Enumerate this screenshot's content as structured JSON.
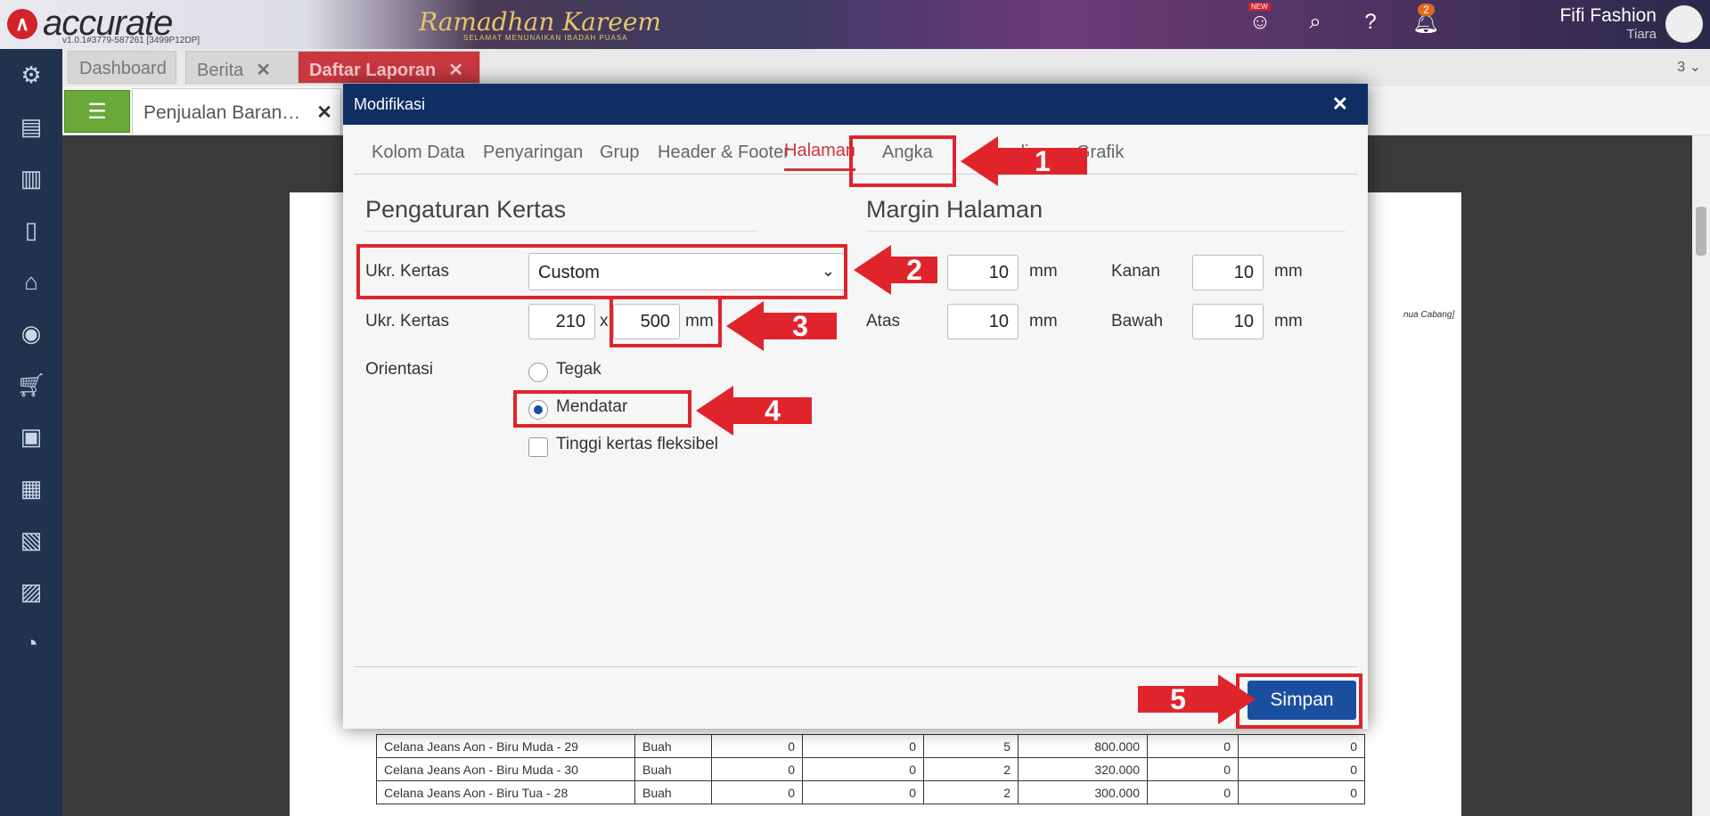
{
  "app": {
    "logo_text": "accurate",
    "logo_version": "v1.0.1#3779-587261 [3499P12DP]",
    "banner_title": "Ramadhan Kareem",
    "banner_subtitle": "SELAMAT MENUNAIKAN IBADAH PUASA",
    "user_name": "Fifi Fashion",
    "user_sub": "Tiara",
    "notif_count": "2",
    "new_label": "NEW"
  },
  "tabs": [
    {
      "label": "Dashboard"
    },
    {
      "label": "Berita"
    },
    {
      "label": "Daftar Laporan"
    }
  ],
  "tab_count": "3",
  "subtab": {
    "label": "Penjualan Baran…"
  },
  "modal": {
    "title": "Modifikasi",
    "tabs": [
      "Kolom Data",
      "Penyaringan",
      "Grup",
      "Header & Footer",
      "Halaman",
      "Angka",
      "Analisa",
      "Grafik"
    ],
    "paper": {
      "section_title": "Pengaturan Kertas",
      "size_label": "Ukr. Kertas",
      "size_value": "Custom",
      "custom_label": "Ukr. Kertas",
      "width": "210",
      "x_sep": "x",
      "height": "500",
      "unit": "mm",
      "orientation_label": "Orientasi",
      "portrait": "Tegak",
      "landscape": "Mendatar",
      "flexible": "Tinggi kertas fleksibel"
    },
    "margin": {
      "section_title": "Margin Halaman",
      "left_value": "10",
      "right_label": "Kanan",
      "right_value": "10",
      "top_label": "Atas",
      "top_value": "10",
      "bottom_label": "Bawah",
      "bottom_value": "10",
      "unit": "mm"
    },
    "save_label": "Simpan"
  },
  "annotations": [
    "1",
    "2",
    "3",
    "4",
    "5"
  ],
  "report": {
    "note": "nua Cabang]",
    "rows": [
      [
        "Celana Jeans Aon - Biru Muda - 29",
        "Buah",
        "0",
        "0",
        "5",
        "800.000",
        "0",
        "0"
      ],
      [
        "Celana Jeans Aon - Biru Muda - 30",
        "Buah",
        "0",
        "0",
        "2",
        "320.000",
        "0",
        "0"
      ],
      [
        "Celana Jeans Aon - Biru Tua - 28",
        "Buah",
        "0",
        "0",
        "2",
        "300.000",
        "0",
        "0"
      ]
    ]
  }
}
